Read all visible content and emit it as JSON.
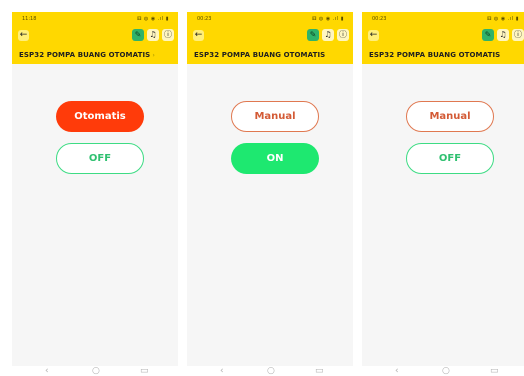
{
  "screens": [
    {
      "status_time": "11:18",
      "status_icons": "⚅ ◍ ◉ .ıl ▮",
      "title": "ESP32 POMPA BUANG OTOMATIS",
      "mode_label": "Otomatis",
      "power_label": "OFF"
    },
    {
      "status_time": "00:23",
      "status_icons": "⚅ ◍ ◉ .ıl ▮",
      "title": "ESP32 POMPA BUANG OTOMATIS",
      "mode_label": "Manual",
      "power_label": "ON"
    },
    {
      "status_time": "00:23",
      "status_icons": "⚅ ◍ ◉ .ıl ▮",
      "title": "ESP32 POMPA BUANG OTOMATIS",
      "mode_label": "Manual",
      "power_label": "OFF"
    }
  ],
  "icons": {
    "back": "arrow-left-icon",
    "wrench": "wrench-icon",
    "bell": "bell-icon",
    "info": "info-icon",
    "nav_back": "chevron-left-icon",
    "nav_home": "home-circle-icon",
    "nav_recents": "recents-icon"
  },
  "glyphs": {
    "back": "←",
    "wrench": "✎",
    "bell": "♫",
    "info": "ⓘ",
    "title_chevron": "›",
    "nav_back": "‹",
    "nav_home": "○",
    "nav_recents": "▭"
  },
  "colors": {
    "topbar": "#ffd800",
    "mode_active": "#ff3b0a",
    "mode_outline": "#e07850",
    "power_on": "#1ee870",
    "power_outline": "#3ddc84"
  }
}
